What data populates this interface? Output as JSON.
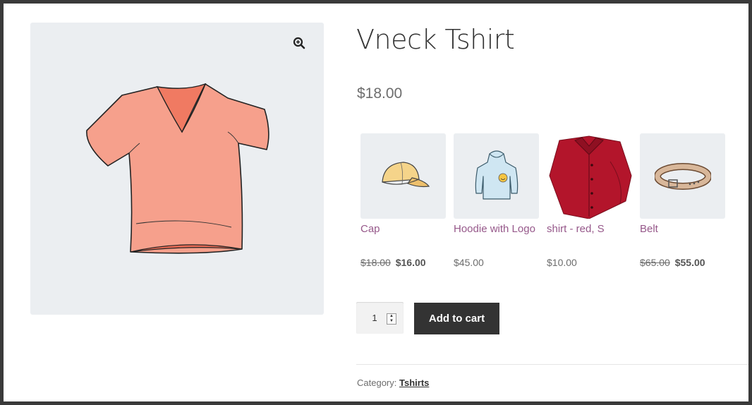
{
  "product": {
    "title": "Vneck Tshirt",
    "price": "$18.00",
    "image_icon": "vneck-tshirt-image"
  },
  "gallery": {
    "zoom_icon": "zoom-icon"
  },
  "related": [
    {
      "name": "Cap",
      "old_price": "$18.00",
      "price": "$16.00",
      "icon": "cap-image"
    },
    {
      "name": "Hoodie with Logo",
      "price": "$45.00",
      "icon": "hoodie-image"
    },
    {
      "name": "shirt - red, S",
      "price": "$10.00",
      "icon": "red-shirt-image"
    },
    {
      "name": "Belt",
      "old_price": "$65.00",
      "price": "$55.00",
      "icon": "belt-image"
    }
  ],
  "cart": {
    "quantity": "1",
    "add_label": "Add to cart"
  },
  "meta": {
    "category_label": "Category:",
    "category_value": "Tshirts"
  },
  "colors": {
    "accent_link": "#96588a",
    "button_bg": "#333333",
    "gallery_bg": "#ebeef1"
  }
}
